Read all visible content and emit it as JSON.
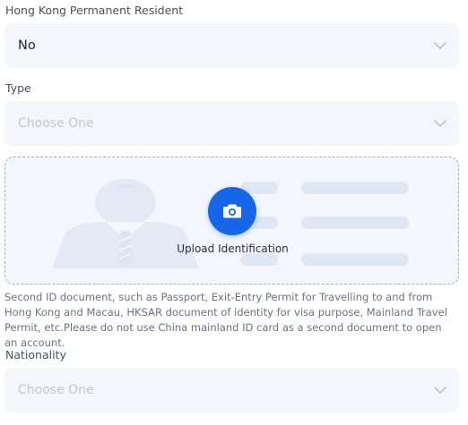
{
  "hk_resident": {
    "label": "Hong Kong Permanent Resident",
    "value": "No"
  },
  "type_field": {
    "label": "Type",
    "placeholder": "Choose One"
  },
  "upload": {
    "label": "Upload Identification"
  },
  "hint": "Second ID document, such as Passport, Exit-Entry Permit for Travelling to and from Hong Kong and Macau, HKSAR document of identity for visa purpose, Mainland Travel Permit, etc.Please do not use China mainland ID card as a second document to open an account.",
  "nationality": {
    "label": "Nationality",
    "placeholder": "Choose One"
  },
  "icons": {
    "chevron": "chevron-down-icon",
    "camera": "camera-icon",
    "illustration": "id-card-illustration"
  },
  "colors": {
    "accent": "#1766e8",
    "field_bg": "#f4f6fb",
    "dashed_border": "#8fb2e6"
  }
}
